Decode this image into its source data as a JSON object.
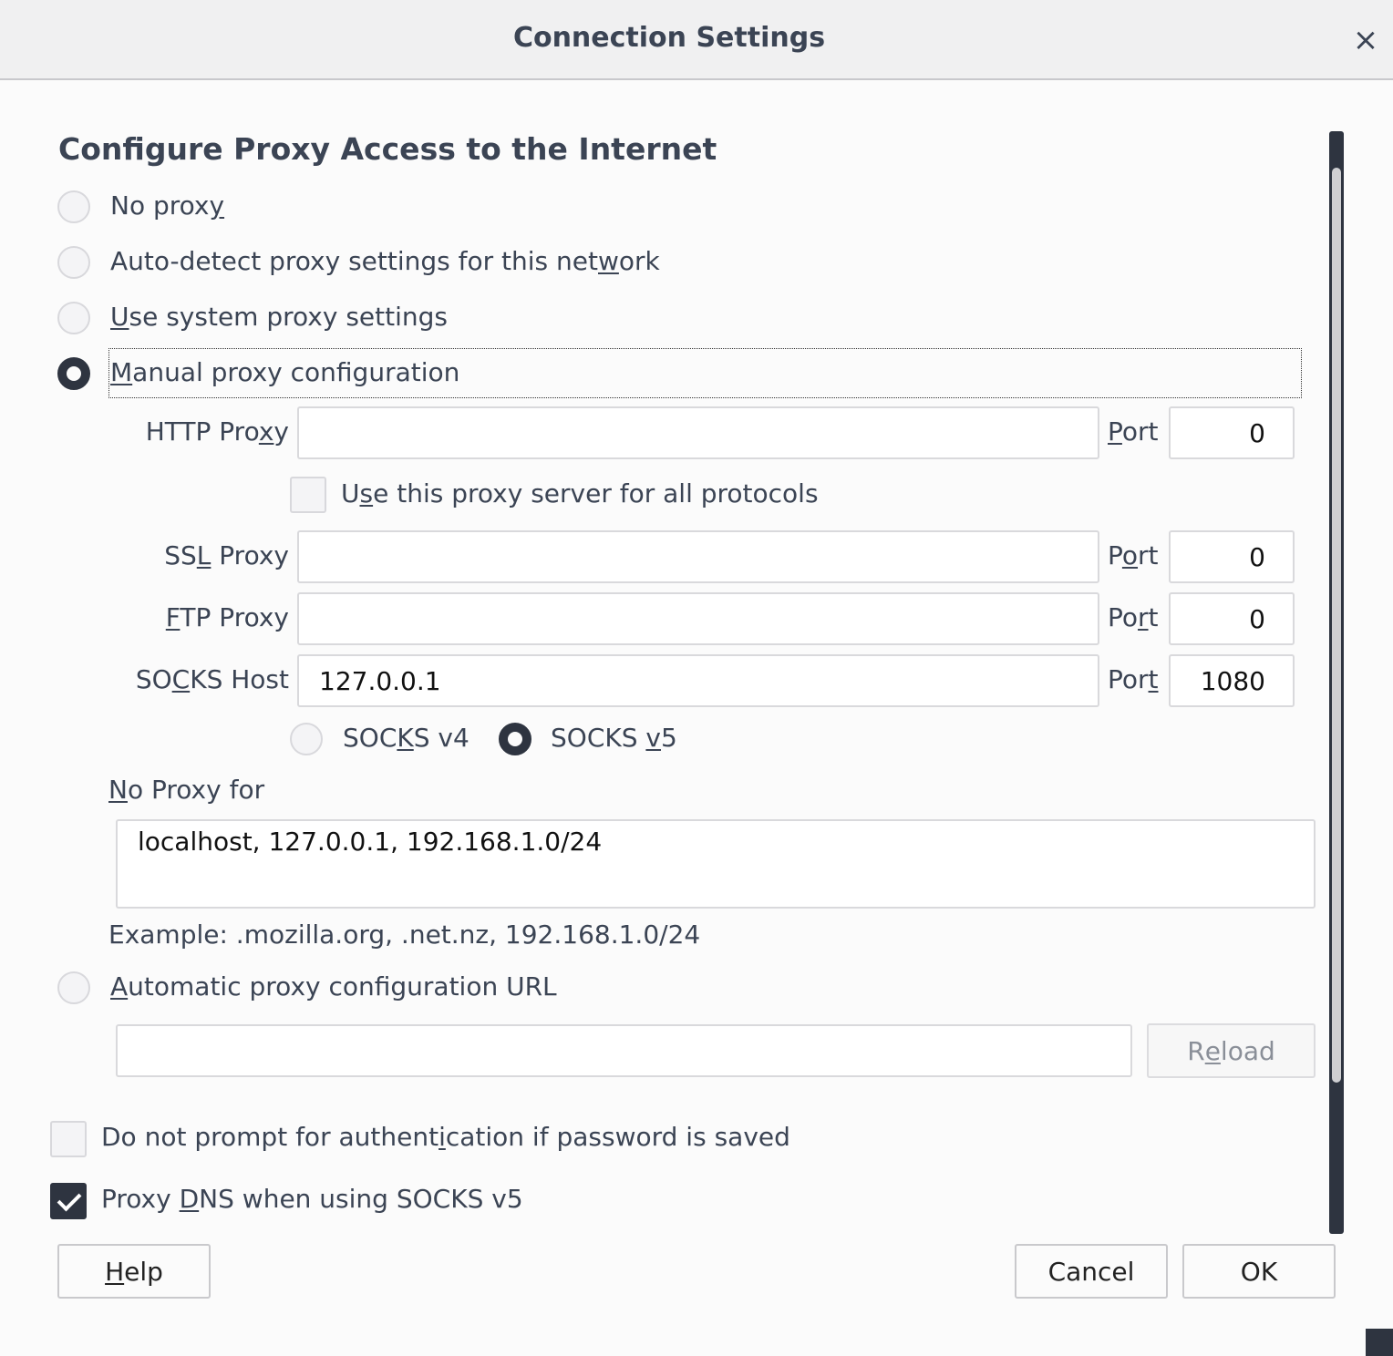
{
  "window": {
    "title": "Connection Settings"
  },
  "heading": "Configure Proxy Access to the Internet",
  "proxy_modes": {
    "no_proxy": {
      "pre": "No prox",
      "ul": "y",
      "post": ""
    },
    "auto_detect": {
      "pre": "Auto-detect proxy settings for this net",
      "ul": "w",
      "post": "ork"
    },
    "system": {
      "pre": "",
      "ul": "U",
      "post": "se system proxy settings"
    },
    "manual": {
      "pre": "",
      "ul": "M",
      "post": "anual proxy configuration",
      "selected": true
    },
    "auto_url": {
      "pre": "",
      "ul": "A",
      "post": "utomatic proxy configuration URL"
    }
  },
  "manual": {
    "http": {
      "pre": "HTTP Pro",
      "ul": "x",
      "post": "y",
      "value": "",
      "port_pre": "",
      "port_ul": "P",
      "port_post": "ort",
      "port": "0"
    },
    "all_protocols": {
      "pre": "U",
      "ul": "s",
      "post": "e this proxy server for all protocols",
      "checked": false
    },
    "ssl": {
      "pre": "SS",
      "ul": "L",
      "post": " Proxy",
      "value": "",
      "port_pre": "P",
      "port_ul": "o",
      "port_post": "rt",
      "port": "0"
    },
    "ftp": {
      "pre": "",
      "ul": "F",
      "post": "TP Proxy",
      "value": "",
      "port_pre": "Po",
      "port_ul": "r",
      "port_post": "t",
      "port": "0"
    },
    "socks": {
      "pre": "SO",
      "ul": "C",
      "post": "KS Host",
      "value": "127.0.0.1",
      "port_pre": "Por",
      "port_ul": "t",
      "port_post": "",
      "port": "1080"
    },
    "socks_v4": {
      "pre": "SOC",
      "ul": "K",
      "post": "S v4",
      "selected": false
    },
    "socks_v5": {
      "pre": "SOCKS ",
      "ul": "v",
      "post": "5",
      "selected": true
    },
    "no_proxy_for": {
      "pre": "",
      "ul": "N",
      "post": "o Proxy for",
      "value": "localhost, 127.0.0.1, 192.168.1.0/24"
    },
    "example": "Example: .mozilla.org, .net.nz, 192.168.1.0/24"
  },
  "auto_url": {
    "value": "",
    "reload": {
      "pre": "R",
      "ul": "e",
      "post": "load"
    }
  },
  "options": {
    "no_auth_prompt": {
      "pre": "Do not prompt for authent",
      "ul": "i",
      "post": "cation if password is saved",
      "checked": false
    },
    "proxy_dns": {
      "pre": "Proxy ",
      "ul": "D",
      "post": "NS when using SOCKS v5",
      "checked": true
    }
  },
  "buttons": {
    "help": {
      "pre": "",
      "ul": "H",
      "post": "elp"
    },
    "cancel": "Cancel",
    "ok": "OK"
  },
  "icons": {
    "close": "close-icon",
    "check": "check-icon"
  },
  "colors": {
    "accent_dark": "#2e3440",
    "text": "#3b4454",
    "field_border": "#d9d9dc"
  }
}
